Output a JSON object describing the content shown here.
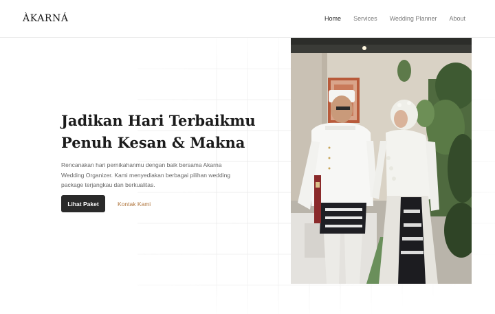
{
  "brand": {
    "logo": "ÀKARNÁ"
  },
  "nav": {
    "items": [
      {
        "label": "Home",
        "active": true
      },
      {
        "label": "Services",
        "active": false
      },
      {
        "label": "Wedding Planner",
        "active": false
      },
      {
        "label": "About",
        "active": false
      }
    ]
  },
  "hero": {
    "title_line1": "Jadikan Hari Terbaikmu",
    "title_line2": "Penuh Kesan & Makna",
    "description": "Rencanakan hari pernikahanmu dengan baik bersama Akarna Wedding Organizer. Kami menyediakan berbagai pilihan wedding package terjangkau dan berkualitas.",
    "primary_button": "Lihat Paket",
    "secondary_link": "Kontak Kami"
  },
  "colors": {
    "accent": "#b0763d",
    "button_bg": "#2a2a2a",
    "text_dark": "#1b1b1b",
    "text_muted": "#666666"
  },
  "image": {
    "subject": "wedding-couple-photo"
  }
}
